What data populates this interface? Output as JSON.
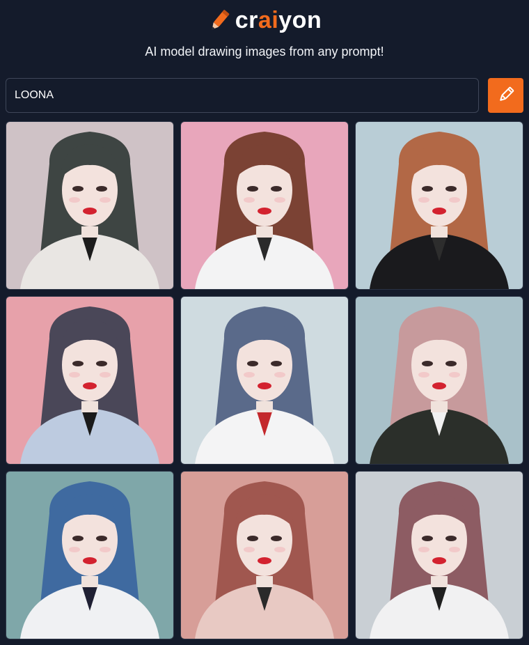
{
  "brand": {
    "name_part1": "cr",
    "name_accent": "ai",
    "name_part2": "yon",
    "accent_color": "#f26b1d",
    "icon": "pencil-icon"
  },
  "tagline": "AI model drawing images from any prompt!",
  "search": {
    "value": "LOONA",
    "button_icon": "pencil-icon"
  },
  "colors": {
    "background": "#141b2b",
    "input_border": "#3f4759",
    "button": "#f26b1d"
  },
  "images": [
    {
      "bg": "#cfc2c6",
      "hair": "#3e4543",
      "top": "#e9e6e3",
      "collar": "#1c1c1c"
    },
    {
      "bg": "#e8a6bb",
      "hair": "#7b4234",
      "top": "#f3f3f4",
      "collar": "#2a2a2a"
    },
    {
      "bg": "#b9cdd6",
      "hair": "#b26846",
      "top": "#1a1a1d",
      "collar": "#2d2d2d"
    },
    {
      "bg": "#e7a1aa",
      "hair": "#4a4758",
      "top": "#bdcbe0",
      "collar": "#1a1a1a"
    },
    {
      "bg": "#cfdbe0",
      "hair": "#5a6a8a",
      "top": "#f4f4f5",
      "collar": "#c3282c"
    },
    {
      "bg": "#a9c1c9",
      "hair": "#c79a9c",
      "top": "#2b2f2a",
      "collar": "#f1f1f1"
    },
    {
      "bg": "#7fa7a9",
      "hair": "#3f6aa0",
      "top": "#f0f1f3",
      "collar": "#1f2033"
    },
    {
      "bg": "#d79e98",
      "hair": "#a0574f",
      "top": "#e8c9c3",
      "collar": "#2a2a2a"
    },
    {
      "bg": "#c9cfd4",
      "hair": "#8d5c63",
      "top": "#f1f1f2",
      "collar": "#1f1f1f"
    }
  ]
}
